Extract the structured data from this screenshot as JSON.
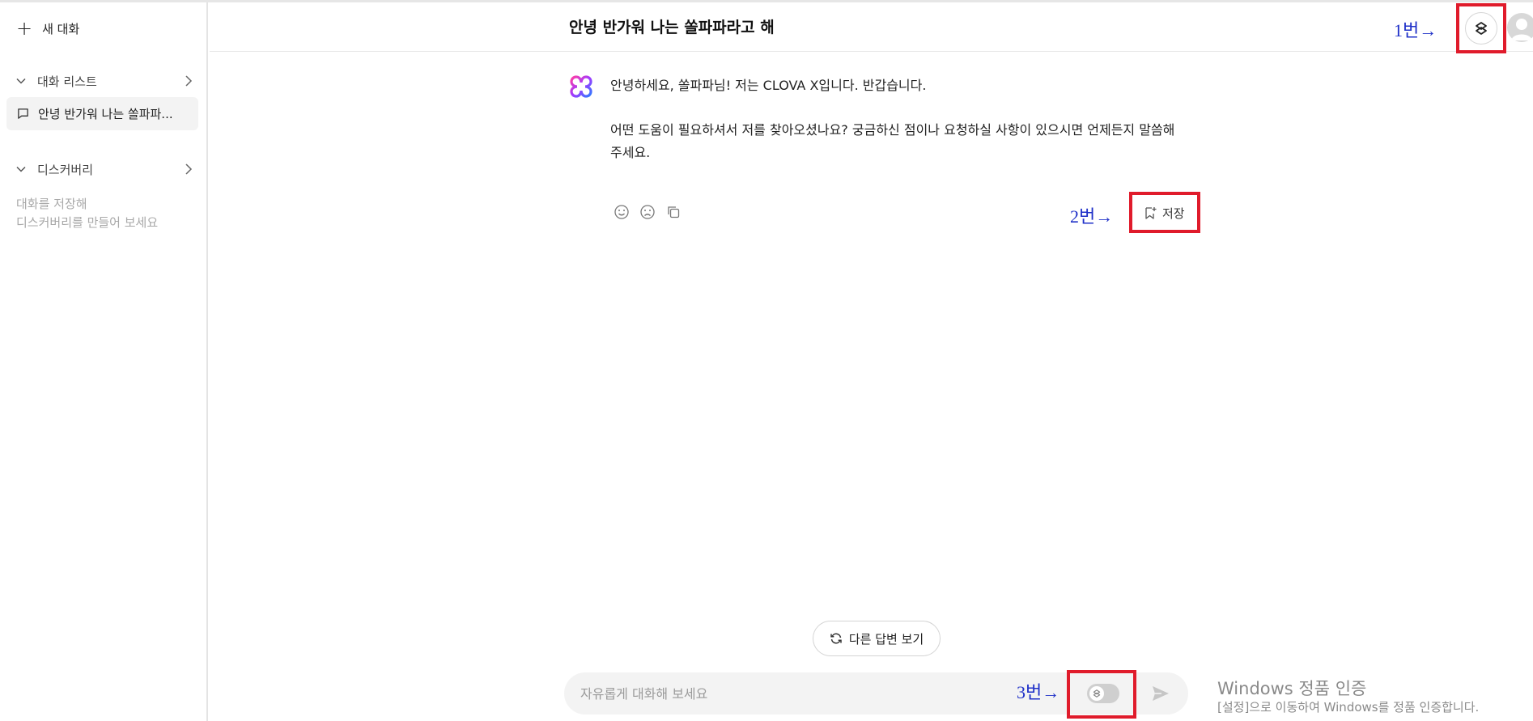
{
  "sidebar": {
    "new_chat_label": "새 대화",
    "conversation_list_label": "대화 리스트",
    "conversations": [
      {
        "label": "안녕 반가워 나는 쏠파파..."
      }
    ],
    "discovery_label": "디스커버리",
    "discovery_hint_line1": "대화를 저장해",
    "discovery_hint_line2": "디스커버리를 만들어 보세요"
  },
  "header": {
    "title": "안녕 반가워 나는 쏠파파라고 해"
  },
  "message": {
    "line1": "안녕하세요, 쏠파파님! 저는 CLOVA X입니다. 반갑습니다.",
    "line2": "어떤 도움이 필요하셔서 저를 찾아오셨나요? 궁금하신 점이나 요청하실 사항이 있으시면 언제든지 말씀해주세요."
  },
  "actions": {
    "save_label": "저장"
  },
  "annotations": {
    "a1": "1번→",
    "a2": "2번→",
    "a3": "3번→"
  },
  "bottom": {
    "regenerate_label": "다른 답변 보기",
    "input_placeholder": "자유롭게 대화해 보세요",
    "input_value": ""
  },
  "watermark": {
    "title": "Windows 정품 인증",
    "subtitle": "[설정]으로 이동하여 Windows를 정품 인증합니다."
  },
  "colors": {
    "annotation": "#1f30c8",
    "highlight_box": "#e01b2b",
    "selected_item_bg": "#f3f3f3"
  },
  "icons": [
    "plus-icon",
    "chevron-down-icon",
    "chevron-right-icon",
    "chat-bubble-icon",
    "clova-x-logo-icon",
    "smile-icon",
    "frown-icon",
    "copy-icon",
    "bookmark-add-icon",
    "refresh-icon",
    "skill-icon",
    "send-icon",
    "avatar-icon"
  ]
}
